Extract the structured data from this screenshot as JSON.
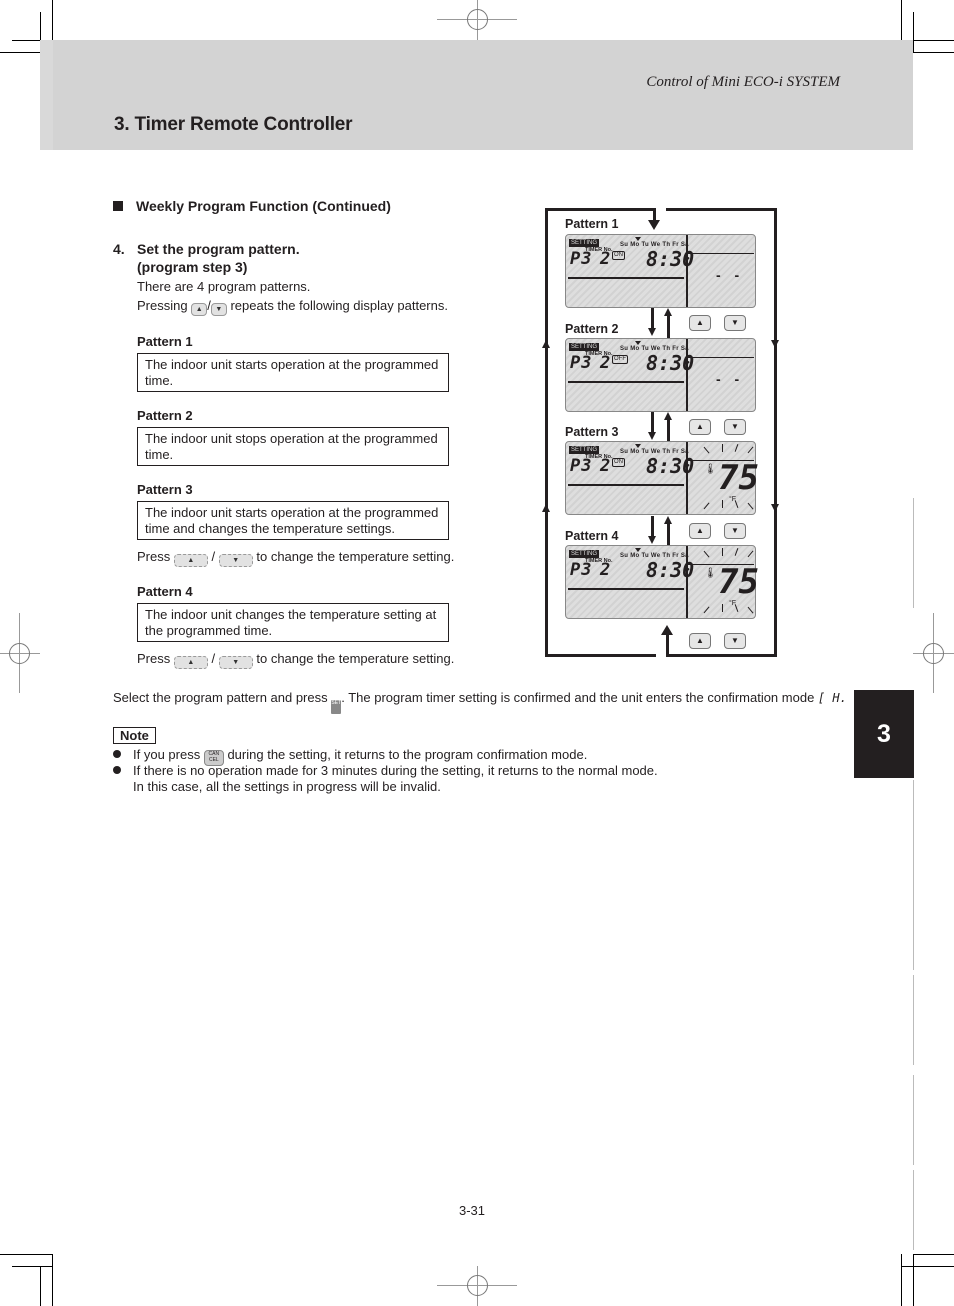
{
  "header": {
    "system_title": "Control of Mini ECO-i SYSTEM",
    "page_title": "3. Timer Remote Controller"
  },
  "section": {
    "title": "Weekly Program Function (Continued)"
  },
  "step": {
    "number": "4.",
    "title_line1": "Set the program pattern.",
    "title_line2": "(program step 3)",
    "intro": "There are 4 program patterns.",
    "pressing_prefix": "Pressing",
    "pressing_sep": "/",
    "pressing_suffix": "repeats the following display patterns."
  },
  "keys": {
    "up": "▲",
    "down": "▼",
    "set": "SET",
    "cancel_line1": "CAN",
    "cancel_line2": "CEL"
  },
  "patterns": [
    {
      "label": "Pattern 1",
      "description": "The indoor unit starts operation at the programmed time.",
      "note": ""
    },
    {
      "label": "Pattern 2",
      "description": "The indoor unit stops operation at the programmed time.",
      "note": ""
    },
    {
      "label": "Pattern 3",
      "description": "The indoor unit starts operation at the programmed time and changes the temperature settings.",
      "note": "to change the temperature setting."
    },
    {
      "label": "Pattern 4",
      "description": "The indoor unit changes the temperature setting at the programmed time.",
      "note": "to change the temperature setting."
    }
  ],
  "press_prefix": "Press",
  "press_sep": "/",
  "diagram": {
    "captions": [
      "Pattern 1",
      "Pattern 2",
      "Pattern 3",
      "Pattern 4"
    ],
    "lcd": {
      "setting_label": "SETTING",
      "timer_no_label": "TIMER No.",
      "days": "Su Mo Tu We Th Fr Sa",
      "program": "P3",
      "timer_number": "2",
      "time": "8:30",
      "onoff_icons": [
        "ON",
        "OFF",
        "ON",
        ""
      ],
      "right_dashes": "- -",
      "temperature": "75",
      "temp_unit": "°F",
      "thermometer_icon": "🌡"
    }
  },
  "confirm": {
    "prefix": "Select the program pattern and press",
    "suffix": ". The program timer setting is confirmed and the unit enters the confirmation mode",
    "mode_symbol": "[ H."
  },
  "note": {
    "badge": "Note",
    "items": [
      {
        "prefix": "If you press",
        "suffix": "during the setting, it returns to the program confirmation mode."
      },
      {
        "text": "If there is no operation made for 3 minutes during the setting, it returns to the normal mode."
      }
    ],
    "continuation": "In this case, all the settings in progress will be invalid."
  },
  "chapter_tab": "3",
  "page_number": "3-31"
}
